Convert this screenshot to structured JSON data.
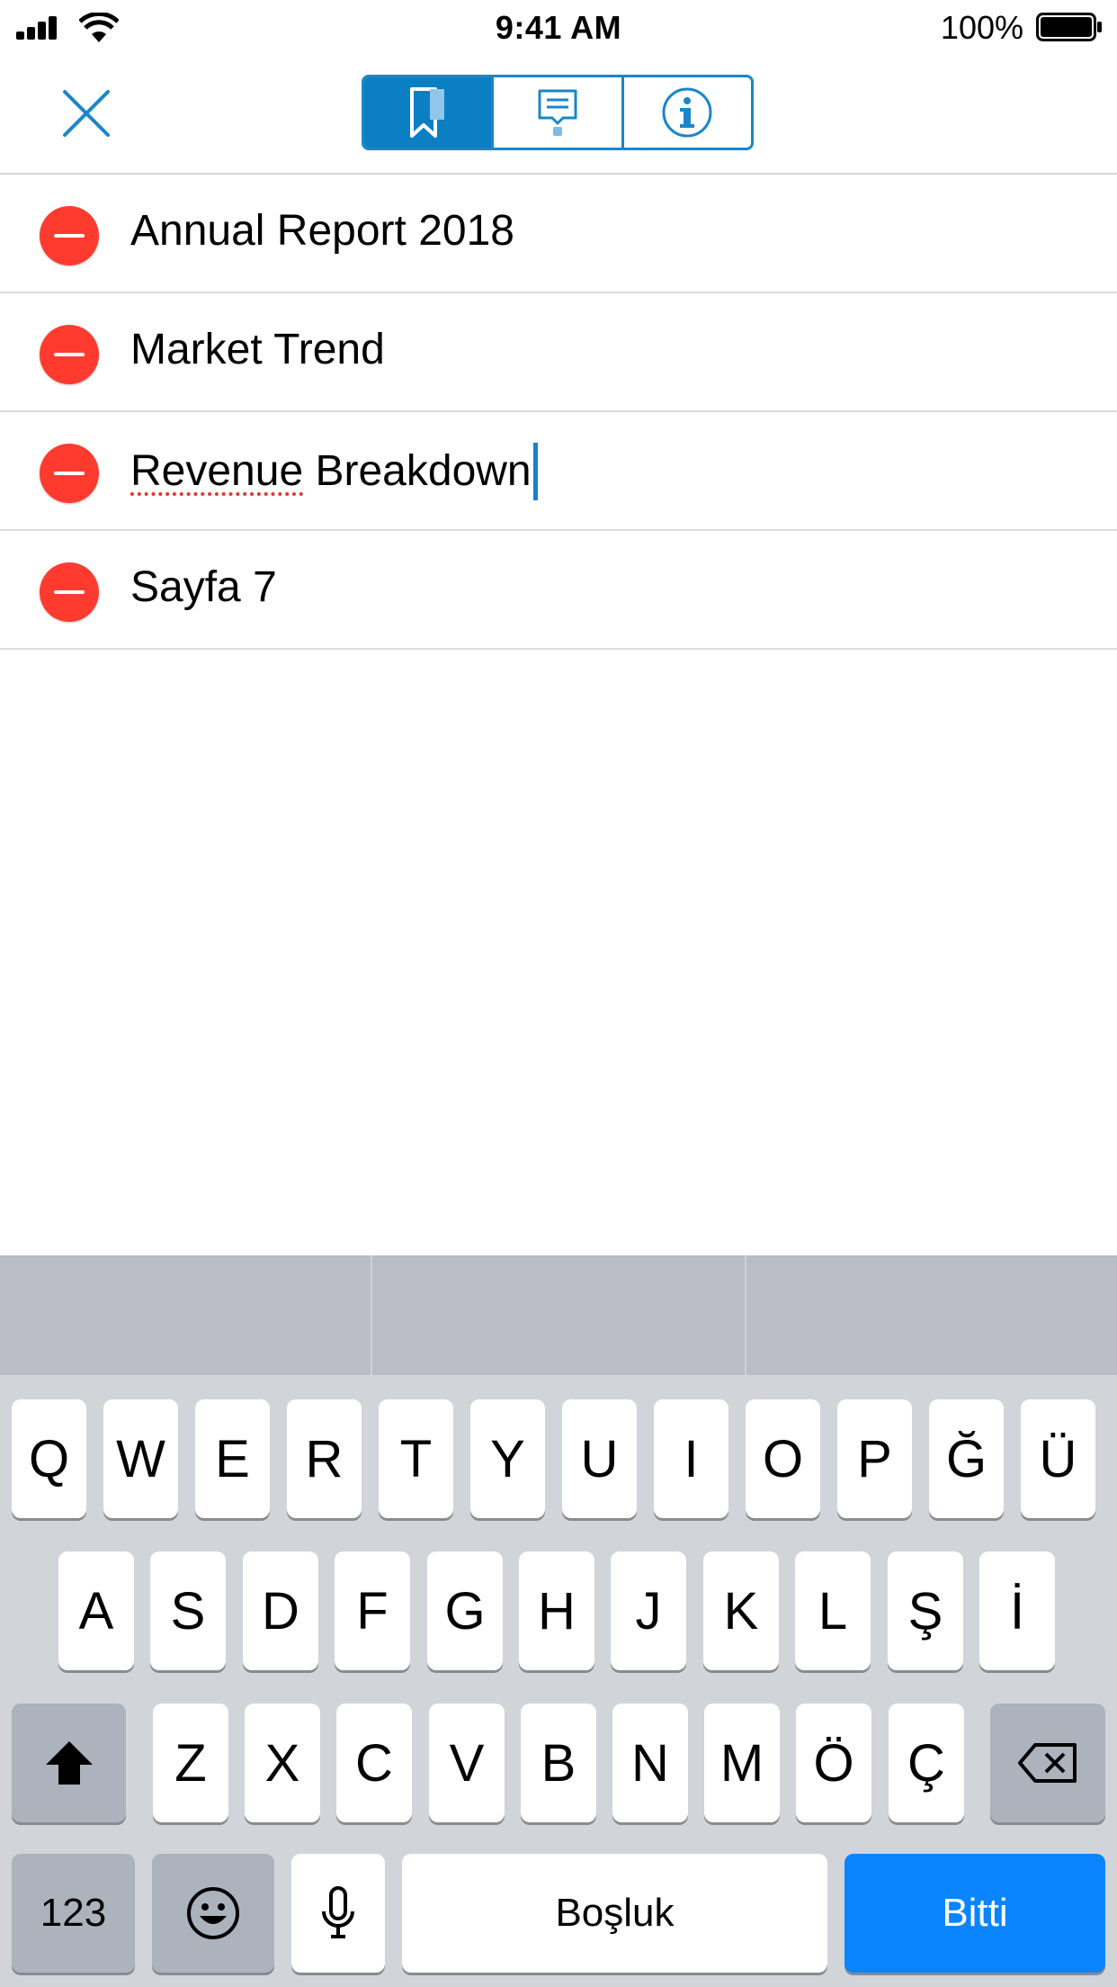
{
  "status_bar": {
    "time": "9:41 AM",
    "battery_percent": "100%",
    "signal_icon": "cellular-signal-icon",
    "wifi_icon": "wifi-icon",
    "battery_icon": "battery-full-icon"
  },
  "toolbar": {
    "close_icon": "close-icon",
    "segments": [
      {
        "icon": "bookmark-icon",
        "active": true
      },
      {
        "icon": "comment-icon",
        "active": false
      },
      {
        "icon": "info-icon",
        "active": false
      }
    ],
    "accent_color": "#0a7fc2"
  },
  "bookmarks": [
    {
      "title": "Annual Report 2018"
    },
    {
      "title": "Market Trend"
    },
    {
      "title_misspelled_part": "Revenue",
      "title_rest": " Breakdown",
      "editing": true
    },
    {
      "title": "Sayfa 7"
    }
  ],
  "delete_color": "#ff3b30",
  "keyboard": {
    "row1": [
      "Q",
      "W",
      "E",
      "R",
      "T",
      "Y",
      "U",
      "I",
      "O",
      "P",
      "Ğ",
      "Ü"
    ],
    "row2": [
      "A",
      "S",
      "D",
      "F",
      "G",
      "H",
      "J",
      "K",
      "L",
      "Ş",
      "İ"
    ],
    "row3": [
      "Z",
      "X",
      "C",
      "V",
      "B",
      "N",
      "M",
      "Ö",
      "Ç"
    ],
    "numbers_key": "123",
    "space_key": "Boşluk",
    "done_key": "Bitti",
    "done_color": "#0a84ff"
  }
}
